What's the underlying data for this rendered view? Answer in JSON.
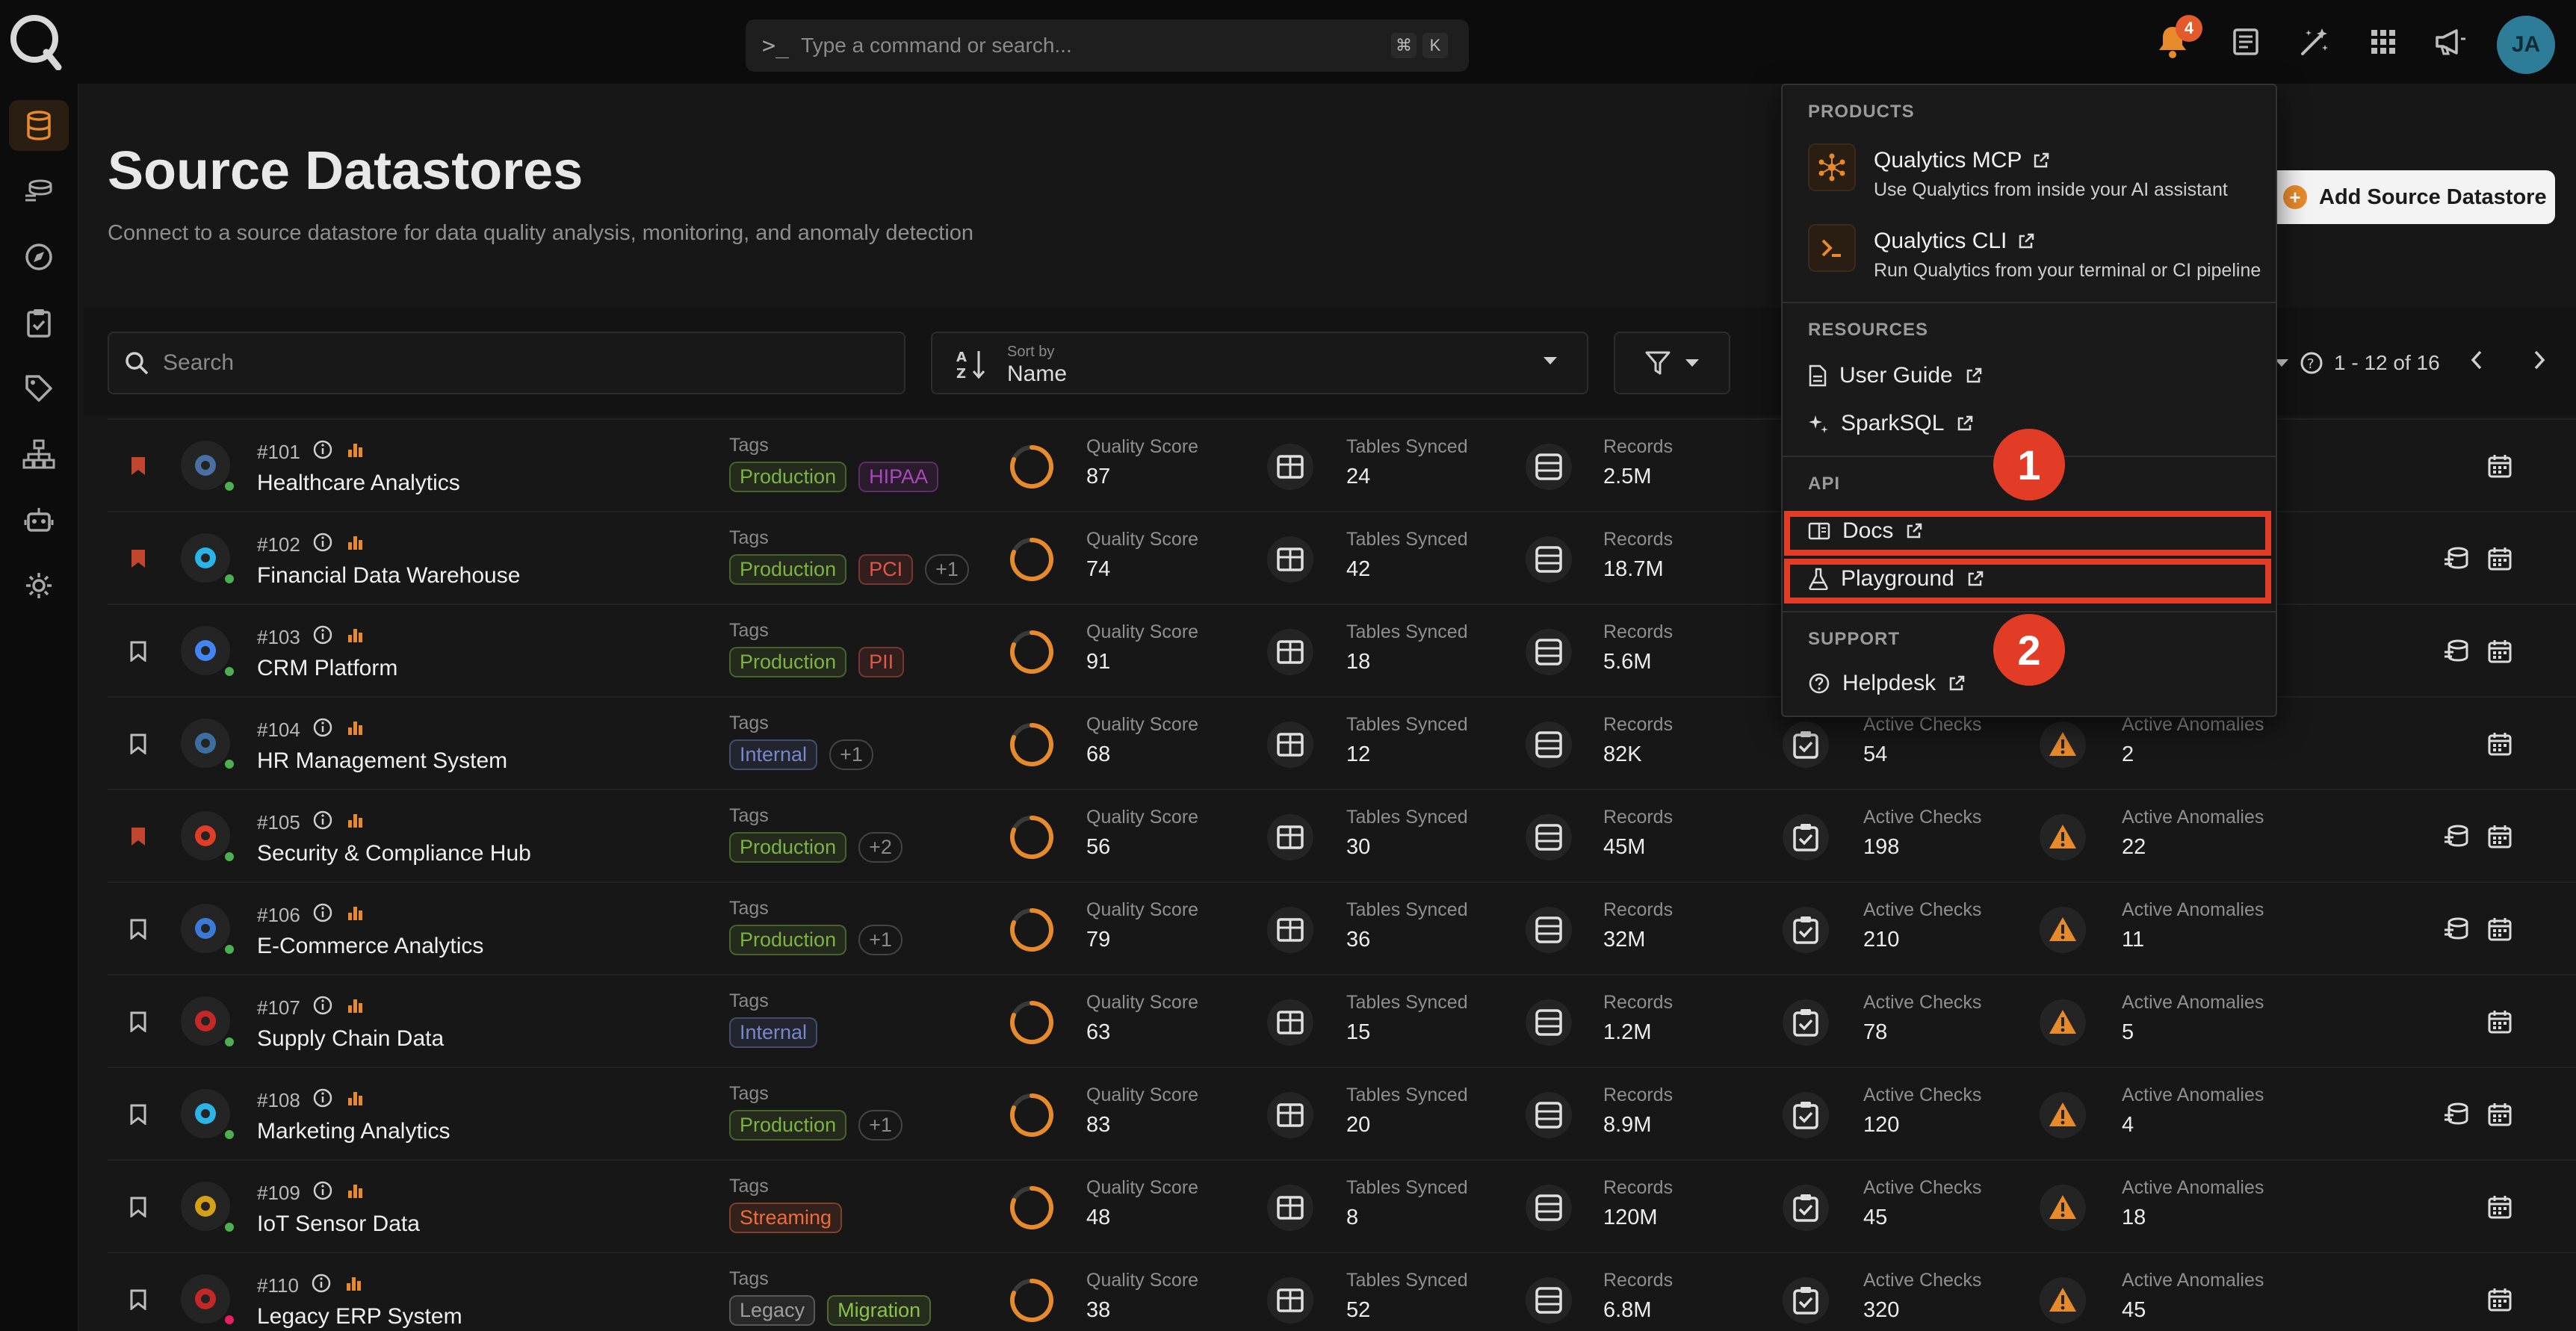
{
  "command_bar": {
    "placeholder": "Type a command or search...",
    "kbd_1": "⌘",
    "kbd_2": "K"
  },
  "header": {
    "notification_count": "4",
    "avatar_initials": "JA"
  },
  "page": {
    "title": "Source Datastores",
    "subtitle": "Connect to a source datastore for data quality analysis, monitoring, and anomaly detection",
    "add_button": "Add Source Datastore"
  },
  "toolbar": {
    "search_placeholder": "Search",
    "sort_label": "Sort by",
    "sort_value": "Name",
    "pagination": "1 - 12 of 16"
  },
  "columns": {
    "tags": "Tags",
    "quality": "Quality Score",
    "tables": "Tables Synced",
    "records": "Records",
    "checks": "Active Checks",
    "anomalies": "Active Anomalies"
  },
  "rows": [
    {
      "id": "#101",
      "name": "Healthcare Analytics",
      "tags": [
        "Production",
        "HIPAA"
      ],
      "quality": "87",
      "tables": "24",
      "records": "2.5M",
      "checks": "",
      "anomalies": "",
      "bookmarked": true,
      "status_color": "#4caf50",
      "icon_color": "#4a6fa5"
    },
    {
      "id": "#102",
      "name": "Financial Data Warehouse",
      "tags": [
        "Production",
        "PCI",
        "+1"
      ],
      "quality": "74",
      "tables": "42",
      "records": "18.7M",
      "checks": "",
      "anomalies": "",
      "bookmarked": true,
      "status_color": "#4caf50",
      "icon_color": "#29b5e8"
    },
    {
      "id": "#103",
      "name": "CRM Platform",
      "tags": [
        "Production",
        "PII"
      ],
      "quality": "91",
      "tables": "18",
      "records": "5.6M",
      "checks": "",
      "anomalies": "",
      "bookmarked": false,
      "status_color": "#4caf50",
      "icon_color": "#4285f4"
    },
    {
      "id": "#104",
      "name": "HR Management System",
      "tags": [
        "Internal",
        "+1"
      ],
      "quality": "68",
      "tables": "12",
      "records": "82K",
      "checks": "54",
      "anomalies": "2",
      "bookmarked": false,
      "status_color": "#4caf50",
      "icon_color": "#3b6fa0"
    },
    {
      "id": "#105",
      "name": "Security & Compliance Hub",
      "tags": [
        "Production",
        "+2"
      ],
      "quality": "56",
      "tables": "30",
      "records": "45M",
      "checks": "198",
      "anomalies": "22",
      "bookmarked": true,
      "status_color": "#4caf50",
      "icon_color": "#e23c26"
    },
    {
      "id": "#106",
      "name": "E-Commerce Analytics",
      "tags": [
        "Production",
        "+1"
      ],
      "quality": "79",
      "tables": "36",
      "records": "32M",
      "checks": "210",
      "anomalies": "11",
      "bookmarked": false,
      "status_color": "#4caf50",
      "icon_color": "#3b7bd8"
    },
    {
      "id": "#107",
      "name": "Supply Chain Data",
      "tags": [
        "Internal"
      ],
      "quality": "63",
      "tables": "15",
      "records": "1.2M",
      "checks": "78",
      "anomalies": "5",
      "bookmarked": false,
      "status_color": "#4caf50",
      "icon_color": "#c62828"
    },
    {
      "id": "#108",
      "name": "Marketing Analytics",
      "tags": [
        "Production",
        "+1"
      ],
      "quality": "83",
      "tables": "20",
      "records": "8.9M",
      "checks": "120",
      "anomalies": "4",
      "bookmarked": false,
      "status_color": "#4caf50",
      "icon_color": "#29b5e8"
    },
    {
      "id": "#109",
      "name": "IoT Sensor Data",
      "tags": [
        "Streaming"
      ],
      "quality": "48",
      "tables": "8",
      "records": "120M",
      "checks": "45",
      "anomalies": "18",
      "bookmarked": false,
      "status_color": "#4caf50",
      "icon_color": "#d4a017"
    },
    {
      "id": "#110",
      "name": "Legacy ERP System",
      "tags": [
        "Legacy",
        "Migration"
      ],
      "quality": "38",
      "tables": "52",
      "records": "6.8M",
      "checks": "320",
      "anomalies": "45",
      "bookmarked": false,
      "status_color": "#e91e63",
      "icon_color": "#c62828"
    }
  ],
  "tag_colors": {
    "Production": "#7cb342",
    "HIPAA": "#ab47bc",
    "PCI": "#e2574c",
    "PII": "#e2574c",
    "Internal": "#7986cb",
    "Streaming": "#ef6c3b",
    "Legacy": "#9e9e9e",
    "Migration": "#8bc34a",
    "plus": "#8a8a8a"
  },
  "menu": {
    "products_header": "PRODUCTS",
    "mcp_title": "Qualytics MCP",
    "mcp_sub": "Use Qualytics from inside your AI assistant",
    "cli_title": "Qualytics CLI",
    "cli_sub": "Run Qualytics from your terminal or CI pipeline",
    "resources_header": "RESOURCES",
    "user_guide": "User Guide",
    "sparksql": "SparkSQL",
    "api_header": "API",
    "docs": "Docs",
    "playground": "Playground",
    "support_header": "SUPPORT",
    "helpdesk": "Helpdesk"
  },
  "callouts": {
    "one": "1",
    "two": "2"
  },
  "colors": {
    "accent": "#e78a2c",
    "callout": "#e23c26",
    "background": "#171717"
  }
}
